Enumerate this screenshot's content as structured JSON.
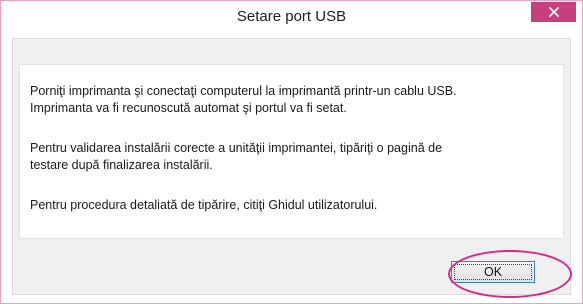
{
  "window": {
    "title": "Setare port USB",
    "close_icon": "close-icon"
  },
  "message": {
    "line1": "Porniţi imprimanta şi conectaţi computerul la imprimantă printr-un cablu USB.",
    "line2": "Imprimanta va fi recunoscută automat şi portul va fi setat.",
    "line3": "Pentru validarea instalării corecte a unităţii imprimantei, tipăriţi o pagină de",
    "line4": "testare după finalizarea instalării.",
    "line5": "Pentru procedura detaliată de tipărire, citiţi Ghidul utilizatorului."
  },
  "buttons": {
    "ok_label": "OK"
  },
  "colors": {
    "close_bg": "#c7407e",
    "window_border": "#e8a2c2",
    "highlight_ring": "#d8288a",
    "focus_border": "#3a7fd1"
  }
}
